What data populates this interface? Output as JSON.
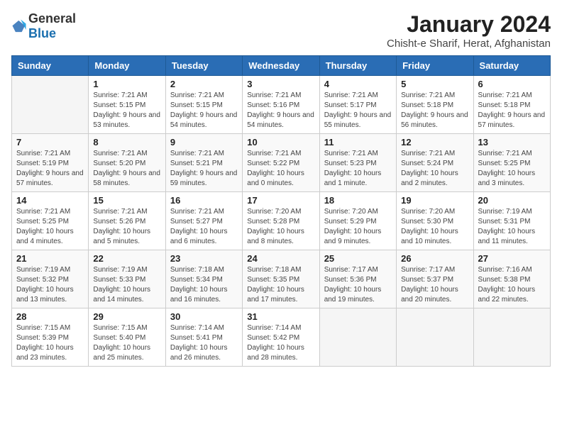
{
  "logo": {
    "general": "General",
    "blue": "Blue"
  },
  "title": "January 2024",
  "subtitle": "Chisht-e Sharif, Herat, Afghanistan",
  "days_of_week": [
    "Sunday",
    "Monday",
    "Tuesday",
    "Wednesday",
    "Thursday",
    "Friday",
    "Saturday"
  ],
  "weeks": [
    [
      {
        "day": "",
        "info": ""
      },
      {
        "day": "1",
        "info": "Sunrise: 7:21 AM\nSunset: 5:15 PM\nDaylight: 9 hours and 53 minutes."
      },
      {
        "day": "2",
        "info": "Sunrise: 7:21 AM\nSunset: 5:15 PM\nDaylight: 9 hours and 54 minutes."
      },
      {
        "day": "3",
        "info": "Sunrise: 7:21 AM\nSunset: 5:16 PM\nDaylight: 9 hours and 54 minutes."
      },
      {
        "day": "4",
        "info": "Sunrise: 7:21 AM\nSunset: 5:17 PM\nDaylight: 9 hours and 55 minutes."
      },
      {
        "day": "5",
        "info": "Sunrise: 7:21 AM\nSunset: 5:18 PM\nDaylight: 9 hours and 56 minutes."
      },
      {
        "day": "6",
        "info": "Sunrise: 7:21 AM\nSunset: 5:18 PM\nDaylight: 9 hours and 57 minutes."
      }
    ],
    [
      {
        "day": "7",
        "info": "Sunrise: 7:21 AM\nSunset: 5:19 PM\nDaylight: 9 hours and 57 minutes."
      },
      {
        "day": "8",
        "info": "Sunrise: 7:21 AM\nSunset: 5:20 PM\nDaylight: 9 hours and 58 minutes."
      },
      {
        "day": "9",
        "info": "Sunrise: 7:21 AM\nSunset: 5:21 PM\nDaylight: 9 hours and 59 minutes."
      },
      {
        "day": "10",
        "info": "Sunrise: 7:21 AM\nSunset: 5:22 PM\nDaylight: 10 hours and 0 minutes."
      },
      {
        "day": "11",
        "info": "Sunrise: 7:21 AM\nSunset: 5:23 PM\nDaylight: 10 hours and 1 minute."
      },
      {
        "day": "12",
        "info": "Sunrise: 7:21 AM\nSunset: 5:24 PM\nDaylight: 10 hours and 2 minutes."
      },
      {
        "day": "13",
        "info": "Sunrise: 7:21 AM\nSunset: 5:25 PM\nDaylight: 10 hours and 3 minutes."
      }
    ],
    [
      {
        "day": "14",
        "info": "Sunrise: 7:21 AM\nSunset: 5:25 PM\nDaylight: 10 hours and 4 minutes."
      },
      {
        "day": "15",
        "info": "Sunrise: 7:21 AM\nSunset: 5:26 PM\nDaylight: 10 hours and 5 minutes."
      },
      {
        "day": "16",
        "info": "Sunrise: 7:21 AM\nSunset: 5:27 PM\nDaylight: 10 hours and 6 minutes."
      },
      {
        "day": "17",
        "info": "Sunrise: 7:20 AM\nSunset: 5:28 PM\nDaylight: 10 hours and 8 minutes."
      },
      {
        "day": "18",
        "info": "Sunrise: 7:20 AM\nSunset: 5:29 PM\nDaylight: 10 hours and 9 minutes."
      },
      {
        "day": "19",
        "info": "Sunrise: 7:20 AM\nSunset: 5:30 PM\nDaylight: 10 hours and 10 minutes."
      },
      {
        "day": "20",
        "info": "Sunrise: 7:19 AM\nSunset: 5:31 PM\nDaylight: 10 hours and 11 minutes."
      }
    ],
    [
      {
        "day": "21",
        "info": "Sunrise: 7:19 AM\nSunset: 5:32 PM\nDaylight: 10 hours and 13 minutes."
      },
      {
        "day": "22",
        "info": "Sunrise: 7:19 AM\nSunset: 5:33 PM\nDaylight: 10 hours and 14 minutes."
      },
      {
        "day": "23",
        "info": "Sunrise: 7:18 AM\nSunset: 5:34 PM\nDaylight: 10 hours and 16 minutes."
      },
      {
        "day": "24",
        "info": "Sunrise: 7:18 AM\nSunset: 5:35 PM\nDaylight: 10 hours and 17 minutes."
      },
      {
        "day": "25",
        "info": "Sunrise: 7:17 AM\nSunset: 5:36 PM\nDaylight: 10 hours and 19 minutes."
      },
      {
        "day": "26",
        "info": "Sunrise: 7:17 AM\nSunset: 5:37 PM\nDaylight: 10 hours and 20 minutes."
      },
      {
        "day": "27",
        "info": "Sunrise: 7:16 AM\nSunset: 5:38 PM\nDaylight: 10 hours and 22 minutes."
      }
    ],
    [
      {
        "day": "28",
        "info": "Sunrise: 7:15 AM\nSunset: 5:39 PM\nDaylight: 10 hours and 23 minutes."
      },
      {
        "day": "29",
        "info": "Sunrise: 7:15 AM\nSunset: 5:40 PM\nDaylight: 10 hours and 25 minutes."
      },
      {
        "day": "30",
        "info": "Sunrise: 7:14 AM\nSunset: 5:41 PM\nDaylight: 10 hours and 26 minutes."
      },
      {
        "day": "31",
        "info": "Sunrise: 7:14 AM\nSunset: 5:42 PM\nDaylight: 10 hours and 28 minutes."
      },
      {
        "day": "",
        "info": ""
      },
      {
        "day": "",
        "info": ""
      },
      {
        "day": "",
        "info": ""
      }
    ]
  ]
}
